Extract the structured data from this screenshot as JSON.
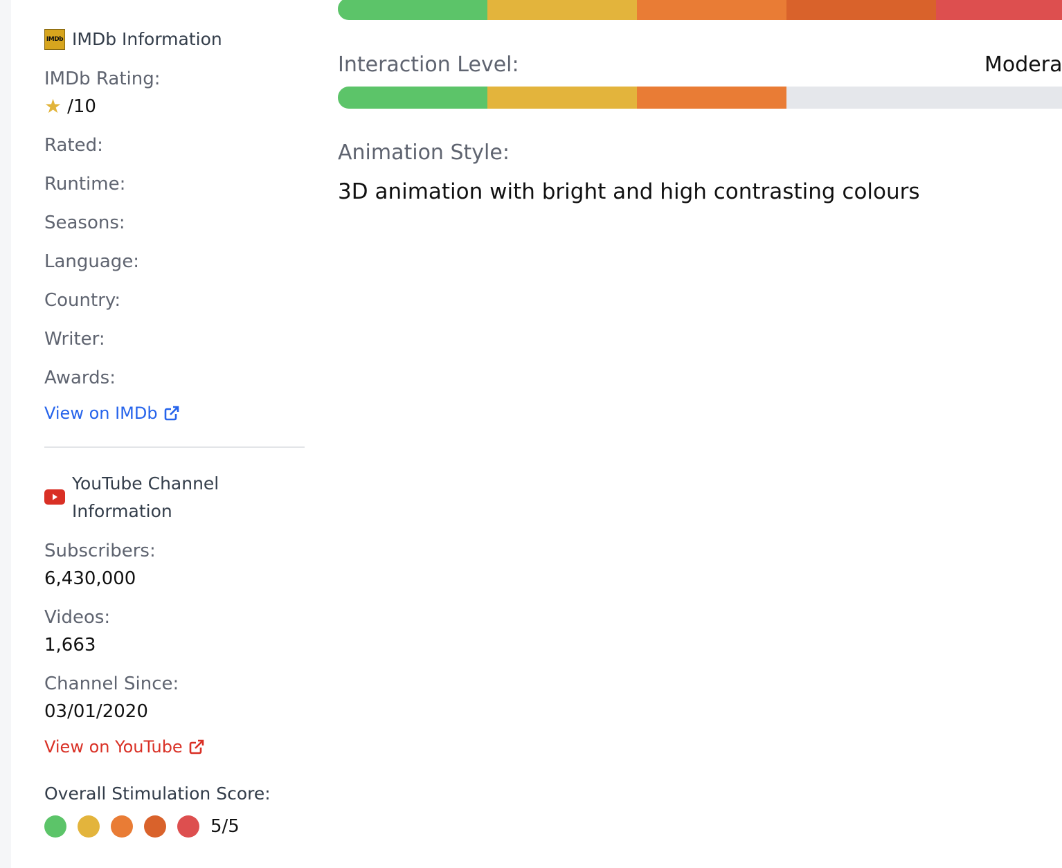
{
  "imdb": {
    "logo_text": "IMDb",
    "heading": "IMDb Information",
    "rating_label": "IMDb Rating:",
    "rating_value": "/10",
    "rated_label": "Rated:",
    "runtime_label": "Runtime:",
    "seasons_label": "Seasons:",
    "language_label": "Language:",
    "country_label": "Country:",
    "writer_label": "Writer:",
    "awards_label": "Awards:",
    "link_label": "View on IMDb"
  },
  "youtube": {
    "heading_line1": "YouTube Channel",
    "heading_line2": "Information",
    "subscribers_label": "Subscribers:",
    "subscribers_value": "6,430,000",
    "videos_label": "Videos:",
    "videos_value": "1,663",
    "since_label": "Channel Since:",
    "since_value": "03/01/2020",
    "link_label": "View on YouTube"
  },
  "score": {
    "title": "Overall Stimulation Score:",
    "value": "5/5",
    "filled": 5,
    "max": 5
  },
  "main": {
    "top_bar_level": 5,
    "interaction_label": "Interaction Level:",
    "interaction_value": "Modera",
    "interaction_level": 3,
    "animation_label": "Animation Style:",
    "animation_value": "3D animation with bright and high contrasting colours"
  },
  "colors": {
    "level1": "#5cc469",
    "level2": "#e3b43c",
    "level3": "#e97c35",
    "level4": "#d9622b",
    "level5": "#dd4f4f",
    "empty": "#e5e7eb",
    "imdb_link": "#2563eb",
    "youtube_link": "#d93025"
  },
  "icons": {
    "star": "star-icon",
    "external": "external-link-icon",
    "youtube": "youtube-icon",
    "imdb": "imdb-logo-icon"
  }
}
